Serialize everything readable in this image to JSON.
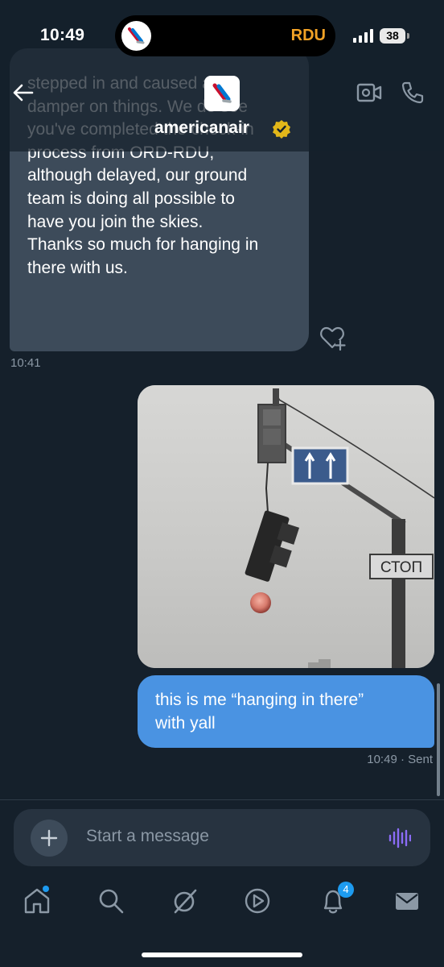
{
  "status_bar": {
    "time": "10:49",
    "island_code": "RDU",
    "battery": "38"
  },
  "header": {
    "account_name": "americanair",
    "avatar_icon": "american-airlines-logo",
    "verified_icon": "verified-gold-badge",
    "actions": [
      "video-call-icon",
      "phone-call-icon"
    ]
  },
  "messages": {
    "incoming": {
      "text": "stepped in and caused a\ndamper on things. We do see\nyou've completed the check-in\nprocess from ORD-RDU,\nalthough delayed, our ground\nteam is doing all possible to\nhave you join the skies.\nThanks so much for hanging in\nthere with us.",
      "time": "10:41"
    },
    "outgoing_photo": {
      "sign_text": "СТОП"
    },
    "outgoing": {
      "text": "this is me “hanging in there”\nwith yall",
      "time": "10:49",
      "status": "· Sent"
    }
  },
  "composer": {
    "placeholder": "Start a message"
  },
  "bottom_nav": {
    "items": [
      "home-icon",
      "search-icon",
      "grok-icon",
      "video-icon",
      "notifications-icon",
      "messages-icon"
    ],
    "notification_count": "4"
  },
  "colors": {
    "background": "#15202b",
    "incoming_bubble": "#3d4b5a",
    "outgoing_bubble": "#4a93e2",
    "accent": "#1d9bf0",
    "verified": "#e2b719",
    "voice_icon": "#8b6cf6"
  }
}
